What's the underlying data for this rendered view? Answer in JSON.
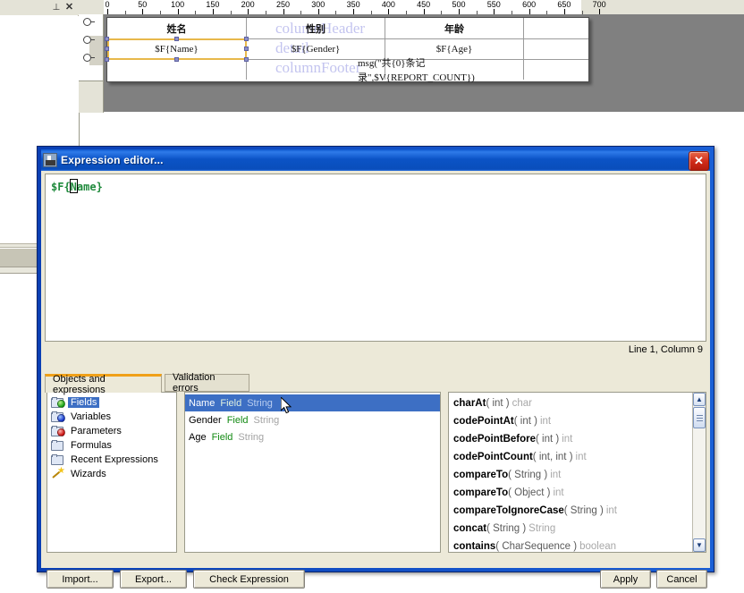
{
  "background_app": {
    "left_panel": {
      "pin_icon": "⊥",
      "close_icon": "✕"
    },
    "ruler": {
      "unit_labels": [
        "0",
        "50",
        "100",
        "150",
        "200",
        "250",
        "300",
        "350",
        "400",
        "450",
        "500",
        "550",
        "600",
        "650",
        "700"
      ],
      "max": 700
    },
    "report": {
      "watermarks": [
        "columnHeader",
        "detail",
        "columnFooter"
      ],
      "rows": [
        {
          "name": "column-header-row",
          "cells": [
            "姓名",
            "性别",
            "年龄",
            ""
          ]
        },
        {
          "name": "detail-row",
          "cells": [
            "$F{Name}",
            "$F{Gender}",
            "$F{Age}",
            ""
          ]
        },
        {
          "name": "column-footer-row",
          "cells": [
            "",
            "",
            "msg(\"共{0}条记录\",$V{REPORT_COUNT})",
            ""
          ]
        }
      ],
      "selected_cell": "$F{Name}"
    }
  },
  "dialog": {
    "title": "Expression editor...",
    "close_label": "✕",
    "editor": {
      "expression": "$F{Name}",
      "status": "Line 1, Column 9"
    },
    "tabs": [
      {
        "label": "Objects and expressions",
        "active": true
      },
      {
        "label": "Validation errors",
        "active": false
      }
    ],
    "tree": {
      "items": [
        {
          "label": "Fields",
          "icon": "folder-green-ball-icon",
          "selected": true
        },
        {
          "label": "Variables",
          "icon": "folder-blue-ball-icon",
          "selected": false
        },
        {
          "label": "Parameters",
          "icon": "folder-red-ball-icon",
          "selected": false
        },
        {
          "label": "Formulas",
          "icon": "folder-icon",
          "selected": false
        },
        {
          "label": "Recent Expressions",
          "icon": "folder-icon",
          "selected": false
        },
        {
          "label": "Wizards",
          "icon": "magic-wand-icon",
          "selected": false
        }
      ]
    },
    "objects": {
      "rows": [
        {
          "name": "Name",
          "kind": "Field",
          "type": "String",
          "selected": true
        },
        {
          "name": "Gender",
          "kind": "Field",
          "type": "String",
          "selected": false
        },
        {
          "name": "Age",
          "kind": "Field",
          "type": "String",
          "selected": false
        }
      ]
    },
    "methods": {
      "rows": [
        {
          "name": "charAt",
          "args": "( int )",
          "ret": "char"
        },
        {
          "name": "codePointAt",
          "args": "( int )",
          "ret": "int"
        },
        {
          "name": "codePointBefore",
          "args": "( int )",
          "ret": "int"
        },
        {
          "name": "codePointCount",
          "args": "( int, int )",
          "ret": "int"
        },
        {
          "name": "compareTo",
          "args": "( String )",
          "ret": "int"
        },
        {
          "name": "compareTo",
          "args": "( Object )",
          "ret": "int"
        },
        {
          "name": "compareToIgnoreCase",
          "args": "( String )",
          "ret": "int"
        },
        {
          "name": "concat",
          "args": "( String )",
          "ret": "String"
        },
        {
          "name": "contains",
          "args": "( CharSequence )",
          "ret": "boolean"
        }
      ],
      "scroll_up_icon": "▲",
      "scroll_down_icon": "▼"
    },
    "buttons": {
      "import": "Import...",
      "export": "Export...",
      "check": "Check Expression",
      "apply": "Apply",
      "cancel": "Cancel"
    }
  },
  "colors": {
    "title_blue": "#0a4ebb",
    "accent_orange": "#f0a018",
    "selection_blue": "#3d6fc4",
    "expression_green": "#1f8a3c",
    "watermark_purple": "#c3c4ef",
    "dialog_face": "#ece9d8"
  }
}
